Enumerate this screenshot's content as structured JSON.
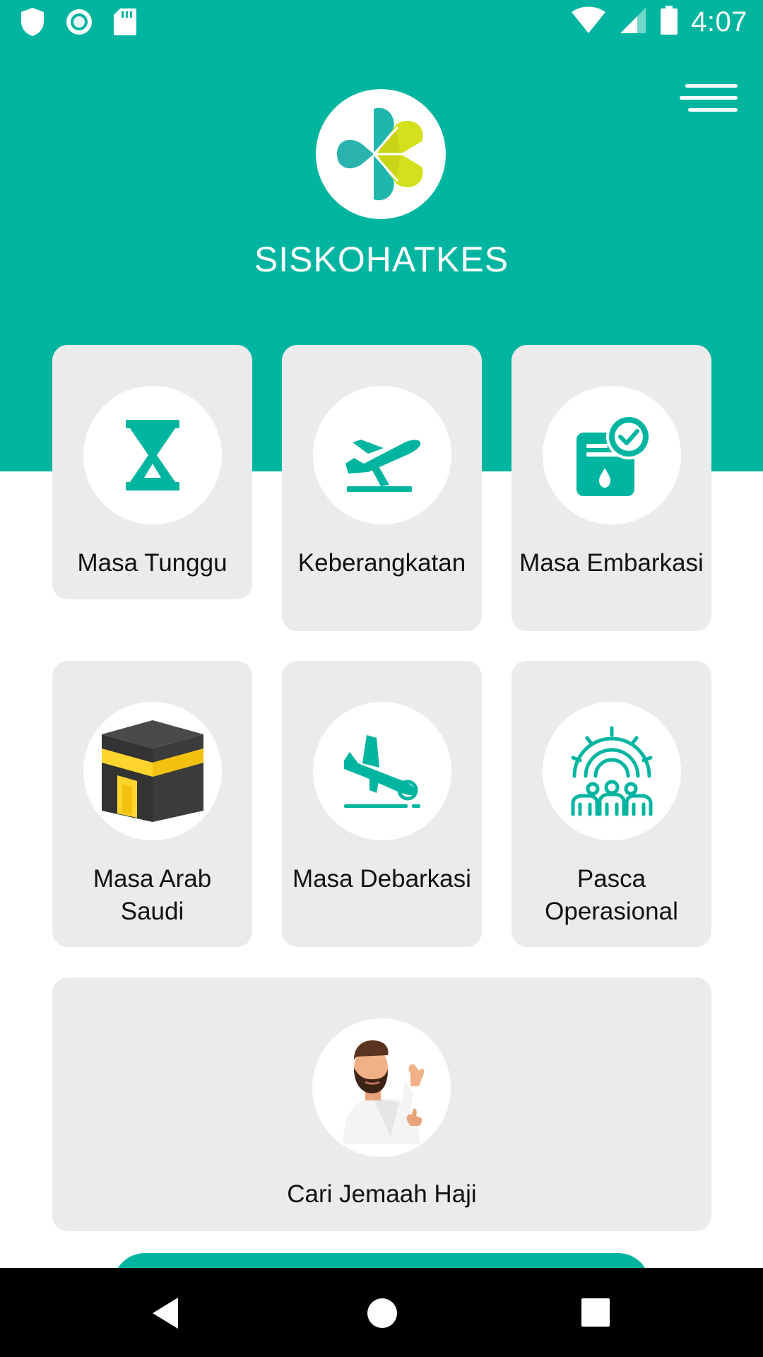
{
  "status_bar": {
    "time": "4:07",
    "left_icons": [
      "shield-icon",
      "radio-icon",
      "sd-card-icon"
    ],
    "right_icons": [
      "wifi-icon",
      "signal-icon",
      "battery-icon"
    ]
  },
  "header": {
    "app_title": "SISKOHATKES",
    "menu_icon": "hamburger-menu-icon",
    "logo_icon": "kemenkes-logo-icon"
  },
  "menu_cards": [
    {
      "label": "Masa Tunggu",
      "icon": "hourglass-icon"
    },
    {
      "label": "Keberangkatan",
      "icon": "airplane-takeoff-icon"
    },
    {
      "label": "Masa Embarkasi",
      "icon": "document-check-icon"
    },
    {
      "label": "Masa Arab Saudi",
      "icon": "kaaba-icon"
    },
    {
      "label": "Masa Debarkasi",
      "icon": "airplane-landing-icon"
    },
    {
      "label": "Pasca Operasional",
      "icon": "people-gear-icon"
    }
  ],
  "search_card": {
    "label": "Cari Jemaah Haji",
    "icon": "pilgrim-avatar-icon"
  },
  "nav_bar": {
    "icons": [
      "back-icon",
      "home-icon",
      "recents-icon"
    ]
  },
  "colors": {
    "primary": "#00B5A0",
    "card_bg": "#EBEBEB",
    "logo_teal": "#1FB6AE",
    "logo_lime": "#D4E01B",
    "kaaba_gold": "#FFD52E",
    "kaaba_black": "#3A3A3A"
  }
}
